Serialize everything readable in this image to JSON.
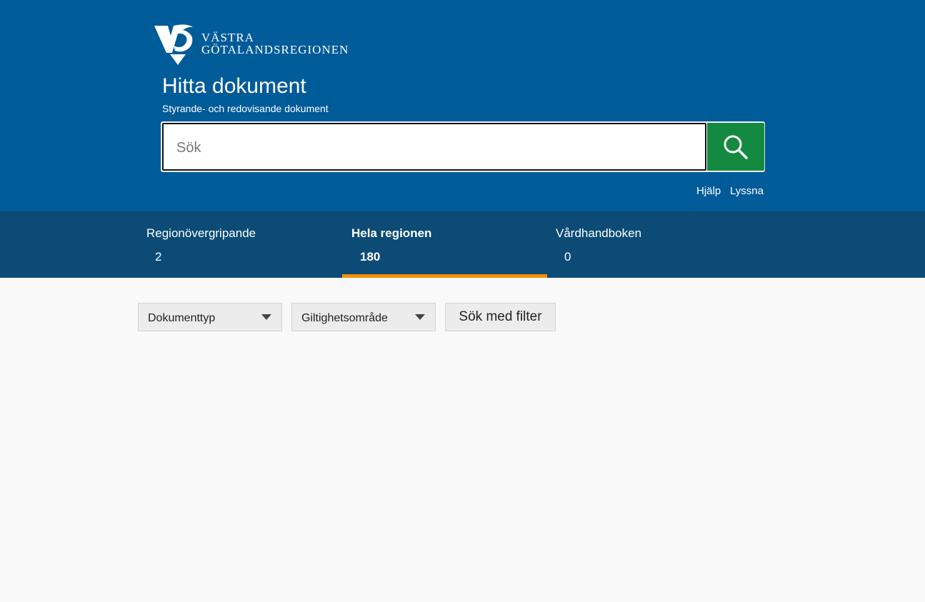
{
  "header": {
    "logo": {
      "line1": "VÄSTRA",
      "line2": "GÖTALANDSREGIONEN",
      "icon": "vgr-logo-icon"
    },
    "title": "Hitta dokument",
    "subtitle": "Styrande- och redovisande dokument"
  },
  "search": {
    "placeholder": "Sök",
    "value": "",
    "button_icon": "search-icon"
  },
  "util_links": {
    "help": "Hjälp",
    "listen": "Lyssna"
  },
  "tabs": [
    {
      "label": "Regionövergripande",
      "count": "2",
      "active": false
    },
    {
      "label": "Hela regionen",
      "count": "180",
      "active": true
    },
    {
      "label": "Vårdhandboken",
      "count": "0",
      "active": false
    }
  ],
  "filters": {
    "document_type": "Dokumenttyp",
    "validity_area": "Giltighetsområde",
    "search_button": "Sök med filter"
  },
  "colors": {
    "header_bg": "#005b99",
    "tabbar_bg": "#0b4b76",
    "search_button": "#138a40",
    "active_tab_underline": "#f39200",
    "page_bg": "#f9f9f9"
  }
}
